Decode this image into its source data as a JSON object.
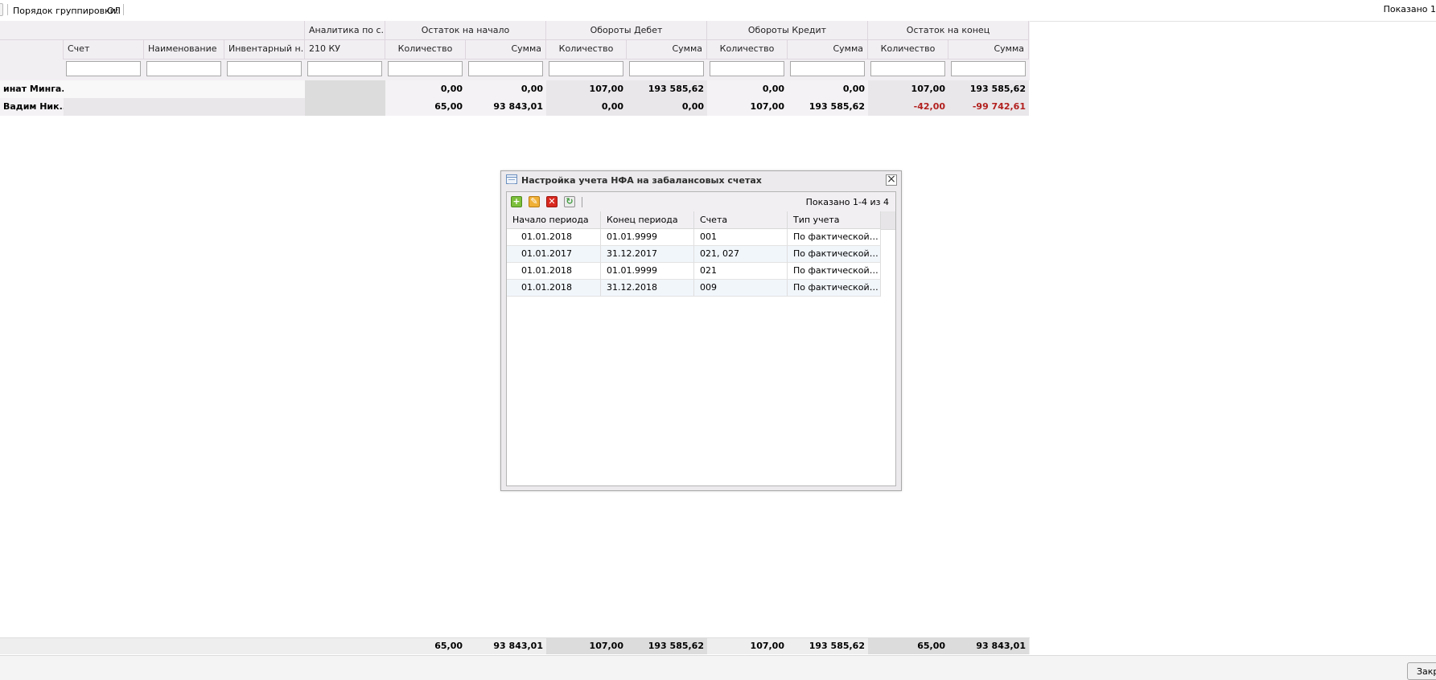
{
  "toolbar": {
    "grouping_label": "Порядок группировки:",
    "grouping_value": "ОЛ",
    "shown_text": "Показано 1"
  },
  "grid": {
    "group_headers": {
      "analytics": "Аналитика по с...",
      "opening": "Остаток на начало",
      "debit": "Обороты Дебет",
      "credit": "Обороты Кредит",
      "closing": "Остаток на конец"
    },
    "columns": {
      "account": "Счет",
      "name": "Наименование",
      "inventory": "Инвентарный н...",
      "ku": "210 КУ",
      "qty_open": "Количество",
      "sum_open": "Сумма",
      "qty_debit": "Количество",
      "sum_debit": "Сумма",
      "qty_credit": "Количество",
      "sum_credit": "Сумма",
      "qty_close": "Количество",
      "sum_close": "Сумма"
    },
    "rows": [
      {
        "label": "инат Минга...",
        "qty_open": "0,00",
        "sum_open": "0,00",
        "qty_debit": "107,00",
        "sum_debit": "193 585,62",
        "qty_credit": "0,00",
        "sum_credit": "0,00",
        "qty_close": "107,00",
        "sum_close": "193 585,62"
      },
      {
        "label": "Вадим Ник...",
        "qty_open": "65,00",
        "sum_open": "93 843,01",
        "qty_debit": "0,00",
        "sum_debit": "0,00",
        "qty_credit": "107,00",
        "sum_credit": "193 585,62",
        "qty_close": "-42,00",
        "sum_close": "-99 742,61"
      }
    ],
    "totals": {
      "qty_open": "65,00",
      "sum_open": "93 843,01",
      "qty_debit": "107,00",
      "sum_debit": "193 585,62",
      "qty_credit": "107,00",
      "sum_credit": "193 585,62",
      "qty_close": "65,00",
      "sum_close": "93 843,01"
    },
    "negative_color": "#b2201e"
  },
  "dialog": {
    "title": "Настройка учета НФА на забалансовых счетах",
    "shown_text": "Показано 1-4 из 4",
    "columns": {
      "start": "Начало периода",
      "end": "Конец периода",
      "accounts": "Счета",
      "type": "Тип учета"
    },
    "rows": [
      {
        "start": "01.01.2018",
        "end": "01.01.9999",
        "accounts": "001",
        "type": "По фактической ст..."
      },
      {
        "start": "01.01.2017",
        "end": "31.12.2017",
        "accounts": "021, 027",
        "type": "По фактической ст..."
      },
      {
        "start": "01.01.2018",
        "end": "01.01.9999",
        "accounts": "021",
        "type": "По фактической ст..."
      },
      {
        "start": "01.01.2018",
        "end": "31.12.2018",
        "accounts": "009",
        "type": "По фактической ст..."
      }
    ],
    "icons": [
      "add-icon",
      "edit-icon",
      "delete-icon",
      "refresh-icon",
      "grid-window-icon",
      "close-icon"
    ]
  },
  "footer": {
    "close_button": "Закрыть"
  }
}
